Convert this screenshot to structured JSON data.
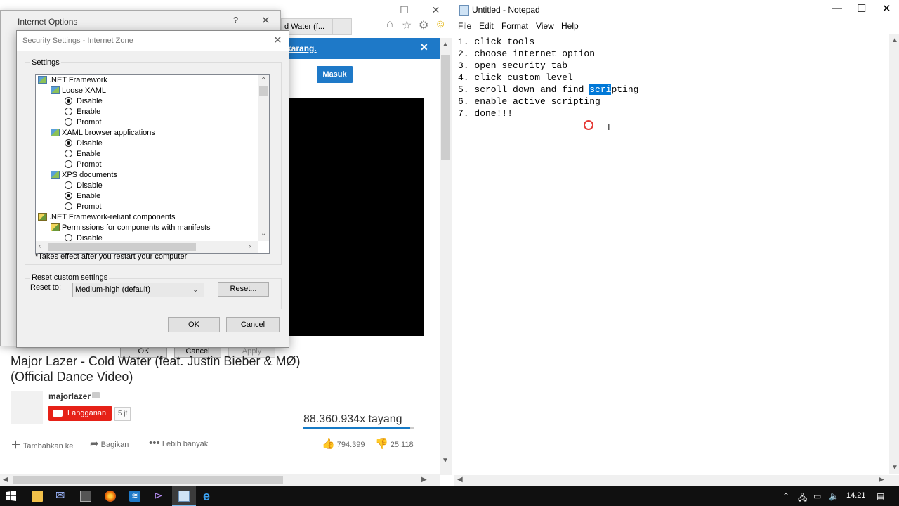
{
  "browser": {
    "tab_title": "d Water (f...",
    "notification_bar": "karang.",
    "login_button": "Masuk",
    "video_title": "Major Lazer - Cold Water (feat. Justin Bieber & MØ) (Official Dance Video)",
    "channel_name": "majorlazer",
    "subscribe_label": "Langganan",
    "subscriber_count": "5 jt",
    "view_count": "88.360.934x tayang",
    "like_ratio": 0.97,
    "actions": {
      "add_to": "Tambahkan ke",
      "share": "Bagikan",
      "more": "Lebih banyak",
      "likes": "794.399",
      "dislikes": "25.118"
    }
  },
  "internet_options": {
    "title": "Internet Options",
    "help": "?",
    "close": "✕",
    "ok": "OK",
    "cancel": "Cancel",
    "apply": "Apply"
  },
  "security_settings": {
    "title": "Security Settings - Internet Zone",
    "settings_label": "Settings",
    "tree": [
      {
        "kind": "category",
        "label": ".NET Framework",
        "level": 0
      },
      {
        "kind": "category",
        "label": "Loose XAML",
        "level": 1
      },
      {
        "kind": "option",
        "label": "Disable",
        "checked": true
      },
      {
        "kind": "option",
        "label": "Enable",
        "checked": false
      },
      {
        "kind": "option",
        "label": "Prompt",
        "checked": false
      },
      {
        "kind": "category",
        "label": "XAML browser applications",
        "level": 1
      },
      {
        "kind": "option",
        "label": "Disable",
        "checked": true
      },
      {
        "kind": "option",
        "label": "Enable",
        "checked": false
      },
      {
        "kind": "option",
        "label": "Prompt",
        "checked": false
      },
      {
        "kind": "category",
        "label": "XPS documents",
        "level": 1
      },
      {
        "kind": "option",
        "label": "Disable",
        "checked": false
      },
      {
        "kind": "option",
        "label": "Enable",
        "checked": true
      },
      {
        "kind": "option",
        "label": "Prompt",
        "checked": false
      },
      {
        "kind": "category",
        "label": ".NET Framework-reliant components",
        "level": 0,
        "cert": true
      },
      {
        "kind": "category",
        "label": "Permissions for components with manifests",
        "level": 1,
        "cert": true
      },
      {
        "kind": "option",
        "label": "Disable",
        "checked": false
      }
    ],
    "restart_note": "*Takes effect after you restart your computer",
    "reset_group_label": "Reset custom settings",
    "reset_to_label": "Reset to:",
    "reset_level": "Medium-high (default)",
    "reset_button": "Reset...",
    "ok": "OK",
    "cancel": "Cancel"
  },
  "notepad": {
    "title": "Untitled - Notepad",
    "menu": [
      "File",
      "Edit",
      "Format",
      "View",
      "Help"
    ],
    "lines": [
      "1. click tools",
      "2. choose internet option",
      "3. open security tab",
      "4. click custom level"
    ],
    "line5_before": "5. scroll down and find ",
    "line5_selected": "scri",
    "line5_after": "pting",
    "lines_after": [
      "6. enable active scripting",
      "7. done!!!"
    ]
  },
  "taskbar": {
    "clock": "14.21"
  },
  "colors": {
    "accent_blue": "#1e79c8",
    "youtube_red": "#e62117",
    "selection": "#0078d7"
  }
}
